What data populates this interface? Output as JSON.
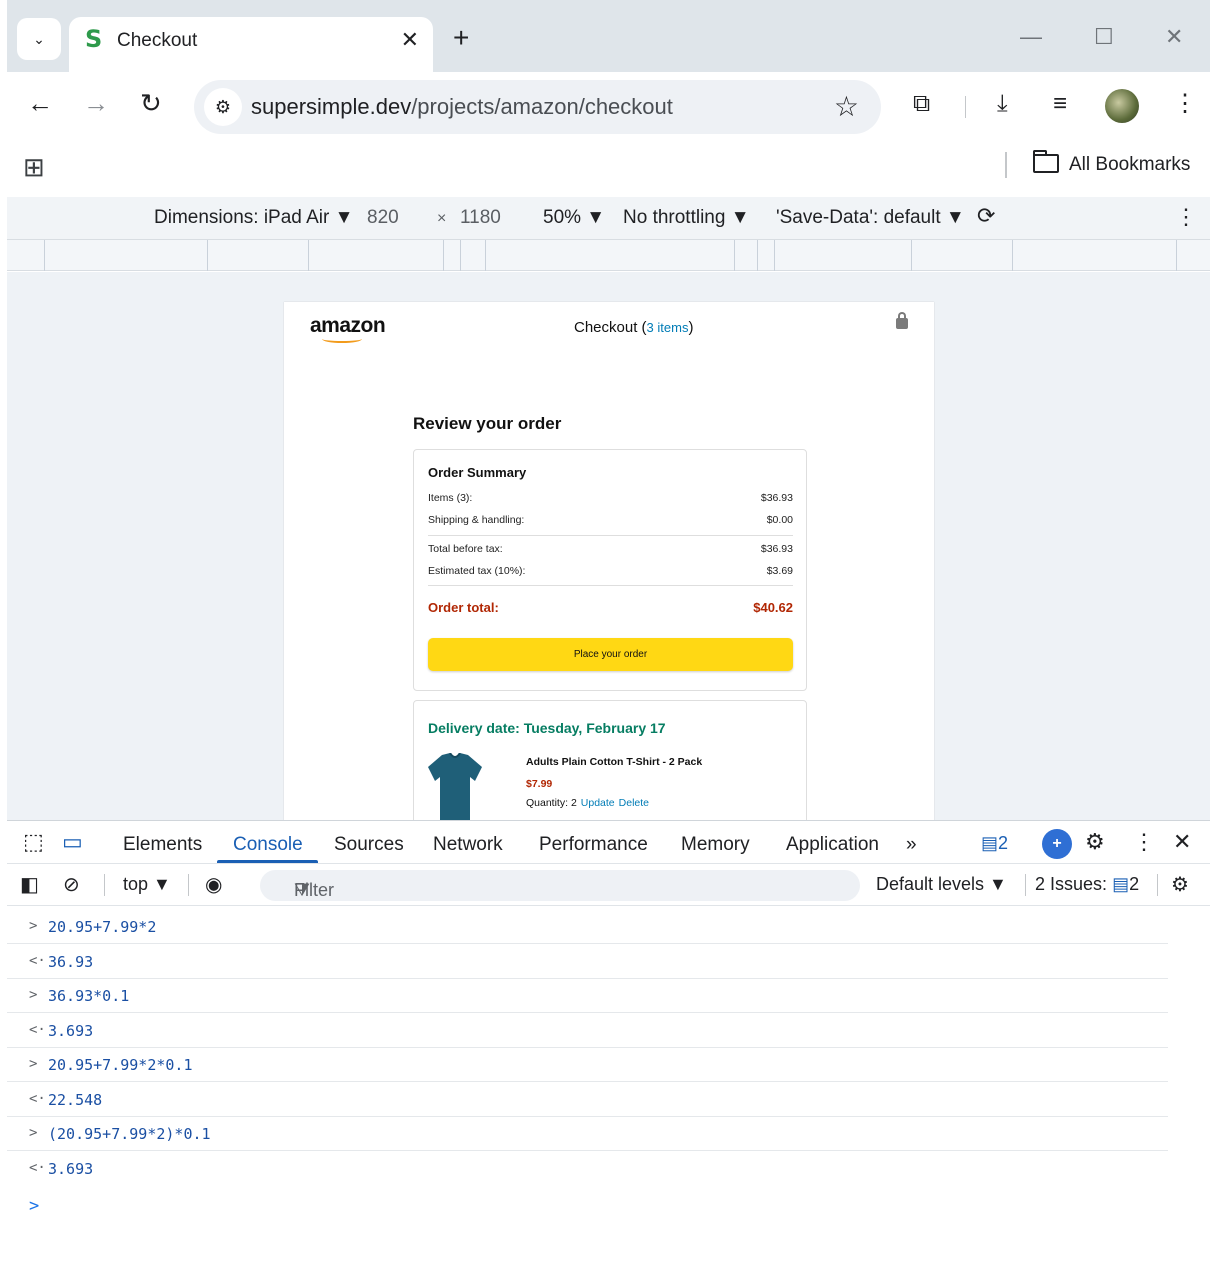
{
  "browser": {
    "tab_title": "Checkout",
    "tab_favicon": "S",
    "url_domain": "supersimple.dev",
    "url_path": "/projects/amazon/checkout",
    "bookmarks_label": "All Bookmarks"
  },
  "device_toolbar": {
    "dimensions_label": "Dimensions: iPad Air ▼",
    "width": "820",
    "times": "×",
    "height": "1180",
    "zoom": "50% ▼",
    "throttling": "No throttling ▼",
    "save_data": "'Save-Data': default ▼"
  },
  "page": {
    "logo": "amazon",
    "checkout_label": "Checkout (",
    "checkout_count": "3 items",
    "checkout_close": ")",
    "review_title": "Review your order",
    "summary": {
      "title": "Order Summary",
      "rows": [
        {
          "label": "Items (3):",
          "value": "$36.93"
        },
        {
          "label": "Shipping & handling:",
          "value": "$0.00"
        },
        {
          "label": "Total before tax:",
          "value": "$36.93"
        },
        {
          "label": "Estimated tax (10%):",
          "value": "$3.69"
        }
      ],
      "total_label": "Order total:",
      "total_value": "$40.62",
      "button": "Place your order"
    },
    "delivery": {
      "date": "Delivery date: Tuesday, February 17",
      "product_name": "Adults Plain Cotton T-Shirt - 2 Pack",
      "price": "$7.99",
      "quantity": "Quantity: 2",
      "update": "Update",
      "delete": "Delete"
    }
  },
  "devtools": {
    "tabs": [
      "Elements",
      "Console",
      "Sources",
      "Network",
      "Performance",
      "Memory",
      "Application"
    ],
    "active_tab": "Console",
    "more": "»",
    "message_count": "2",
    "context": "top ▼",
    "filter_placeholder": "Filter",
    "default_levels": "Default levels ▼",
    "issues_label": "2 Issues:",
    "issues_count": "2",
    "console_lines": [
      {
        "type": "input",
        "arrow": ">",
        "text": "20.95+7.99*2"
      },
      {
        "type": "output",
        "arrow": "<·",
        "text": "36.93"
      },
      {
        "type": "input",
        "arrow": ">",
        "text": "36.93*0.1"
      },
      {
        "type": "output",
        "arrow": "<·",
        "text": "3.693"
      },
      {
        "type": "input",
        "arrow": ">",
        "text": "20.95+7.99*2*0.1"
      },
      {
        "type": "output",
        "arrow": "<·",
        "text": "22.548"
      },
      {
        "type": "input",
        "arrow": ">",
        "text": "(20.95+7.99*2)*0.1"
      },
      {
        "type": "output",
        "arrow": "<·",
        "text": "3.693"
      }
    ],
    "prompt": ">"
  },
  "colors": {
    "accent": "#1a5fb4",
    "amazon_orange": "#f29b1c",
    "place_order_yellow": "#ffd814",
    "delivery_green": "#067d62",
    "price_red": "#b12704"
  }
}
